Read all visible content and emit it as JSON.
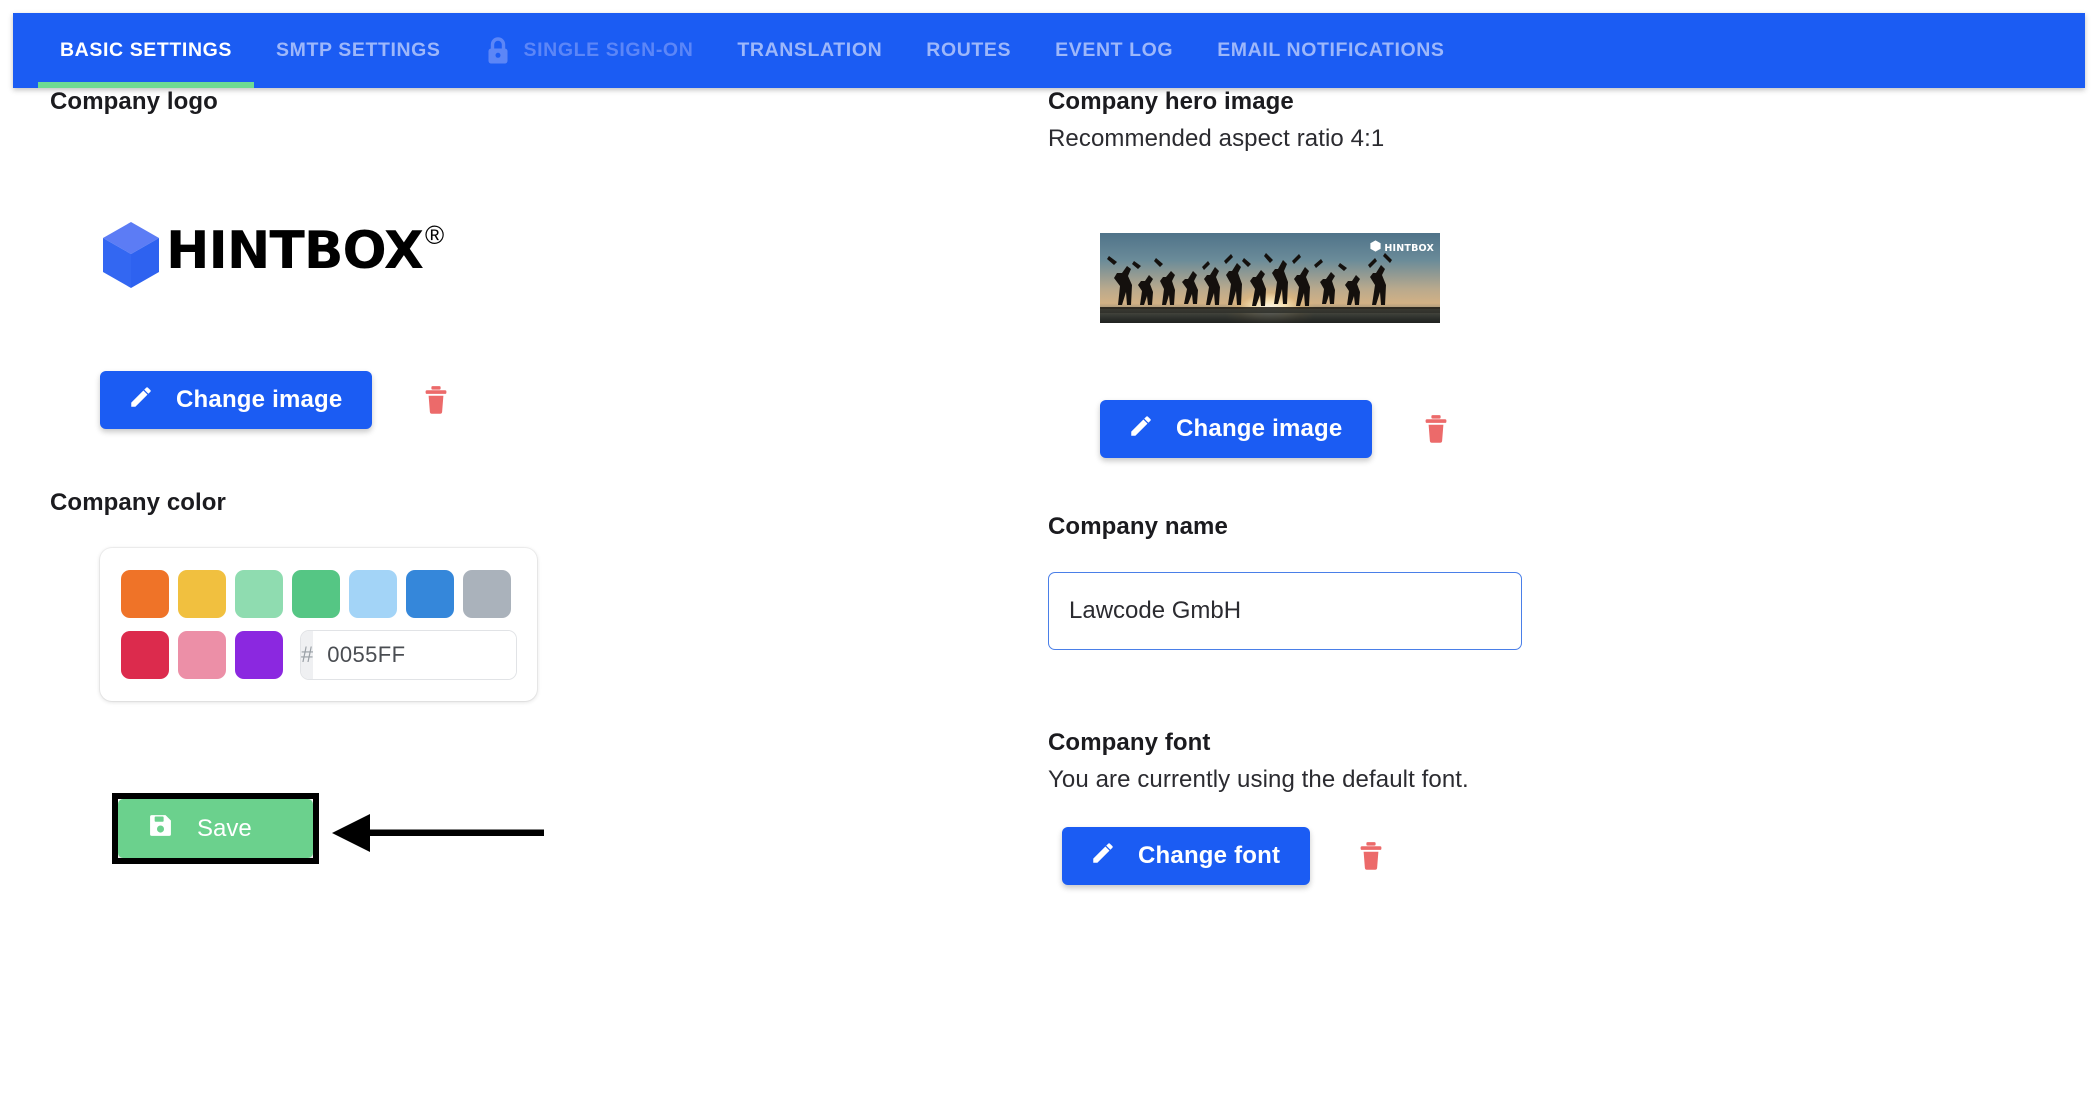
{
  "tabs": [
    {
      "label": "BASIC SETTINGS",
      "active": true,
      "locked": false,
      "icon": null
    },
    {
      "label": "SMTP SETTINGS",
      "active": false,
      "locked": false,
      "icon": null
    },
    {
      "label": "SINGLE SIGN-ON",
      "active": false,
      "locked": true,
      "icon": "lock-icon"
    },
    {
      "label": "TRANSLATION",
      "active": false,
      "locked": false,
      "icon": null
    },
    {
      "label": "ROUTES",
      "active": false,
      "locked": false,
      "icon": null
    },
    {
      "label": "EVENT LOG",
      "active": false,
      "locked": false,
      "icon": null
    },
    {
      "label": "EMAIL NOTIFICATIONS",
      "active": false,
      "locked": false,
      "icon": null
    }
  ],
  "company_logo": {
    "title": "Company logo",
    "logo_text": "HINTBOX",
    "logo_registered_mark": "®",
    "change_button": "Change image",
    "delete_icon": "trash-icon"
  },
  "company_hero": {
    "title": "Company hero image",
    "subtitle": "Recommended aspect ratio 4:1",
    "watermark_text": "HINTBOX",
    "change_button": "Change image",
    "delete_icon": "trash-icon"
  },
  "company_color": {
    "title": "Company color",
    "hash_prefix": "#",
    "hex_value": "0055FF",
    "hex_placeholder": "0055FF",
    "swatches_row1": [
      "#EF7328",
      "#F1C03F",
      "#8FDCB0",
      "#55C684",
      "#A3D4F7",
      "#3587DA",
      "#AAB2BB"
    ],
    "swatches_row2": [
      "#DC2B4D",
      "#EC8FA7",
      "#8B28E0"
    ]
  },
  "save": {
    "label": "Save",
    "icon": "floppy-disk-icon",
    "color": "#6BD18D"
  },
  "company_name": {
    "title": "Company name",
    "value": "Lawcode GmbH",
    "placeholder": "Company name"
  },
  "company_font": {
    "title": "Company font",
    "subtitle": "You are currently using the default font.",
    "change_button": "Change font",
    "delete_icon": "trash-icon"
  },
  "theme": {
    "primary_blue": "#1B5CF3",
    "active_tab_underline": "#6EDB92",
    "trash_red": "#EC6A6A",
    "save_green": "#6BD18D"
  }
}
